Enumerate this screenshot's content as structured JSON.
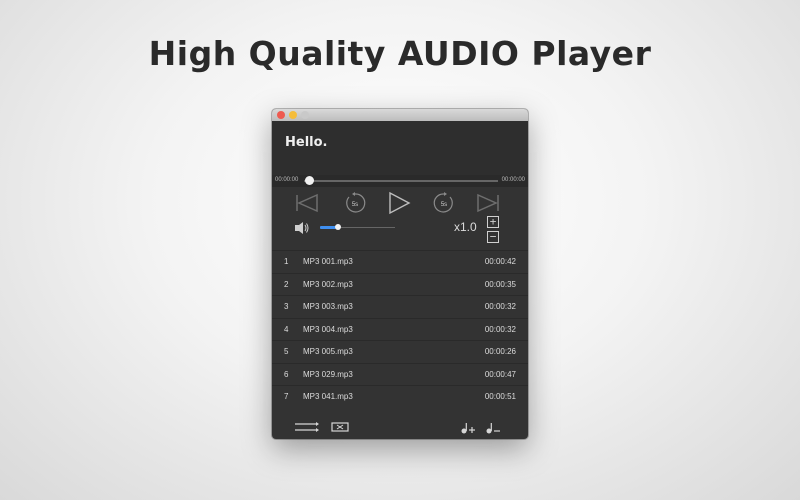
{
  "headline": "High Quality AUDIO Player",
  "window": {
    "header_text": "Hello.",
    "time_elapsed": "00:00:00",
    "time_total": "00:00:00",
    "progress": 0.0,
    "rewind_label": "5s",
    "forward_label": "5s",
    "volume": 0.2,
    "speed": "x1.0",
    "speed_plus": "+",
    "speed_minus": "−",
    "tracks": [
      {
        "num": "1",
        "name": "MP3 001.mp3",
        "duration": "00:00:42"
      },
      {
        "num": "2",
        "name": "MP3 002.mp3",
        "duration": "00:00:35"
      },
      {
        "num": "3",
        "name": "MP3 003.mp3",
        "duration": "00:00:32"
      },
      {
        "num": "4",
        "name": "MP3 004.mp3",
        "duration": "00:00:32"
      },
      {
        "num": "5",
        "name": "MP3 005.mp3",
        "duration": "00:00:26"
      },
      {
        "num": "6",
        "name": "MP3 029.mp3",
        "duration": "00:00:47"
      },
      {
        "num": "7",
        "name": "MP3 041.mp3",
        "duration": "00:00:51"
      }
    ],
    "icons": {
      "prev": "skip-previous-icon",
      "rewind": "rewind-5s-icon",
      "play": "play-icon",
      "forward": "forward-5s-icon",
      "next": "skip-next-icon",
      "speaker": "speaker-icon",
      "playlist_order": "playlist-order-icon",
      "repeat": "repeat-icon",
      "add_track": "add-track-icon",
      "remove_track": "remove-track-icon"
    },
    "colors": {
      "volume_accent": "#3f8ff0",
      "window_bg": "#333333"
    }
  }
}
